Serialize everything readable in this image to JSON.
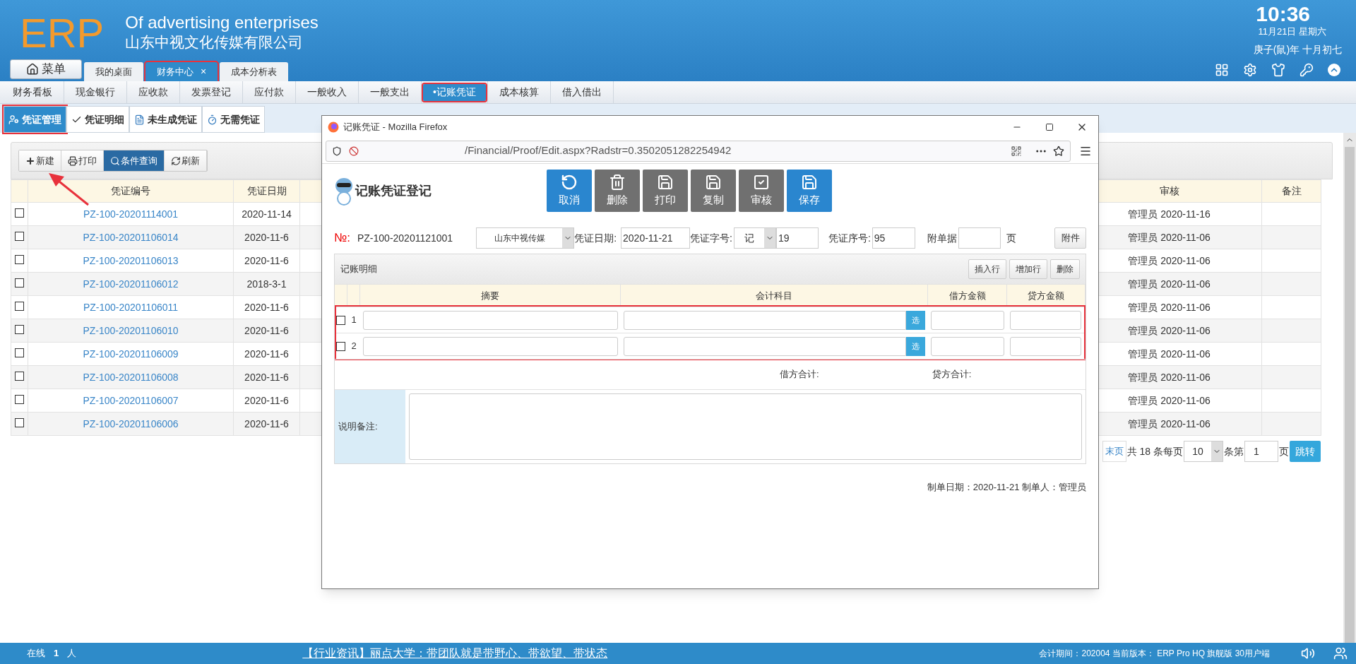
{
  "header": {
    "logo": "ERP",
    "title_en": "Of advertising enterprises",
    "company": "山东中视文化传媒有限公司",
    "menu_button": "菜单",
    "clock": {
      "time": "10:36",
      "date": "11月21日 星期六",
      "lunar": "庚子(鼠)年 十月初七"
    }
  },
  "tabs": [
    {
      "label": "我的桌面",
      "selected": false,
      "highlighted": false
    },
    {
      "label": "财务中心",
      "selected": true,
      "highlighted": true,
      "close": "×"
    },
    {
      "label": "成本分析表",
      "selected": false,
      "highlighted": false
    }
  ],
  "nav": [
    {
      "label": "财务看板",
      "selected": false,
      "highlighted": false
    },
    {
      "label": "现金银行",
      "selected": false,
      "highlighted": false
    },
    {
      "label": "应收款",
      "selected": false,
      "highlighted": false
    },
    {
      "label": "发票登记",
      "selected": false,
      "highlighted": false
    },
    {
      "label": "应付款",
      "selected": false,
      "highlighted": false
    },
    {
      "label": "一般收入",
      "selected": false,
      "highlighted": false
    },
    {
      "label": "一般支出",
      "selected": false,
      "highlighted": false
    },
    {
      "label": "•记账凭证",
      "selected": true,
      "highlighted": true
    },
    {
      "label": "成本核算",
      "selected": false,
      "highlighted": false
    },
    {
      "label": "借入借出",
      "selected": false,
      "highlighted": false
    }
  ],
  "subtabs": [
    {
      "label": "凭证管理",
      "kind": "manage",
      "selected": true,
      "highlighted": true
    },
    {
      "label": "凭证明细",
      "kind": "detail",
      "selected": false,
      "highlighted": false
    },
    {
      "label": "未生成凭证",
      "kind": "pending",
      "selected": false,
      "highlighted": false
    },
    {
      "label": "无需凭证",
      "kind": "none",
      "selected": false,
      "highlighted": false
    }
  ],
  "toolbar": [
    {
      "label": "新建",
      "kind": "new",
      "selected": false,
      "arrow": true
    },
    {
      "label": "打印",
      "kind": "print",
      "selected": false,
      "arrow": false
    },
    {
      "label": "条件查询",
      "kind": "query",
      "selected": true,
      "arrow": false
    },
    {
      "label": "刷新",
      "kind": "refresh",
      "selected": false,
      "arrow": false
    }
  ],
  "table": {
    "columns": [
      "凭证编号",
      "凭证日期",
      "审核",
      "备注"
    ],
    "rows": [
      {
        "checked": false,
        "number": "PZ-100-20201114001",
        "date": "2020-11-14",
        "audit": "管理员 2020-11-16"
      },
      {
        "checked": false,
        "number": "PZ-100-20201106014",
        "date": "2020-11-6",
        "audit": "管理员 2020-11-06"
      },
      {
        "checked": false,
        "number": "PZ-100-20201106013",
        "date": "2020-11-6",
        "audit": "管理员 2020-11-06"
      },
      {
        "checked": false,
        "number": "PZ-100-20201106012",
        "date": "2018-3-1",
        "audit": "管理员 2020-11-06"
      },
      {
        "checked": false,
        "number": "PZ-100-20201106011",
        "date": "2020-11-6",
        "audit": "管理员 2020-11-06"
      },
      {
        "checked": false,
        "number": "PZ-100-20201106010",
        "date": "2020-11-6",
        "audit": "管理员 2020-11-06"
      },
      {
        "checked": false,
        "number": "PZ-100-20201106009",
        "date": "2020-11-6",
        "audit": "管理员 2020-11-06"
      },
      {
        "checked": false,
        "number": "PZ-100-20201106008",
        "date": "2020-11-6",
        "audit": "管理员 2020-11-06"
      },
      {
        "checked": false,
        "number": "PZ-100-20201106007",
        "date": "2020-11-6",
        "audit": "管理员 2020-11-06"
      },
      {
        "checked": false,
        "number": "PZ-100-20201106006",
        "date": "2020-11-6",
        "audit": "管理员 2020-11-06"
      }
    ]
  },
  "pagination": {
    "last": "末页",
    "total": "共 18 条每页",
    "page_size": "10",
    "per": "条第",
    "page": "1",
    "page_unit": "页",
    "go": "跳转"
  },
  "popup": {
    "title": "记账凭证 - Mozilla Firefox",
    "url": "/Financial/Proof/Edit.aspx?Radstr=0.3502051282254942",
    "heading": "记账凭证登记",
    "actions": [
      {
        "label": "取消",
        "kind": "cancel",
        "primary": true
      },
      {
        "label": "删除",
        "kind": "delete",
        "primary": false
      },
      {
        "label": "打印",
        "kind": "print",
        "primary": false
      },
      {
        "label": "复制",
        "kind": "copy",
        "primary": false
      },
      {
        "label": "审核",
        "kind": "audit",
        "primary": false
      },
      {
        "label": "保存",
        "kind": "save",
        "primary": true
      }
    ],
    "form": {
      "no_label": "№:",
      "number": "PZ-100-20201121001",
      "company": "山东中视传媒",
      "date_label": "凭证日期:",
      "date": "2020-11-21",
      "word_label": "凭证字号:",
      "word": "记",
      "word_no": "19",
      "seq_label": "凭证序号:",
      "seq": "95",
      "attach_label": "附单据",
      "attach_unit": "页",
      "attach_button": "附件"
    },
    "detail": {
      "title": "记账明细",
      "buttons": [
        "插入行",
        "增加行",
        "删除"
      ],
      "columns": [
        "摘要",
        "会计科目",
        "借方金额",
        "贷方金额"
      ],
      "highlighted": true,
      "rows": [
        {
          "index": "1",
          "checked": false,
          "pick": "选"
        },
        {
          "index": "2",
          "checked": false,
          "pick": "选"
        }
      ],
      "debit_total": "借方合计:",
      "credit_total": "贷方合计:",
      "remark_label": "说明备注:"
    },
    "footer": "制单日期：2020-11-21  制单人：管理员"
  },
  "status_bar": {
    "online_label": "在线",
    "online_count": "1",
    "online_unit": "人",
    "news": "【行业资讯】丽点大学：带团队就是带野心、带欲望、带状态",
    "info": "会计期间：202004 当前版本： ERP Pro HQ 旗舰版 30用户端"
  }
}
